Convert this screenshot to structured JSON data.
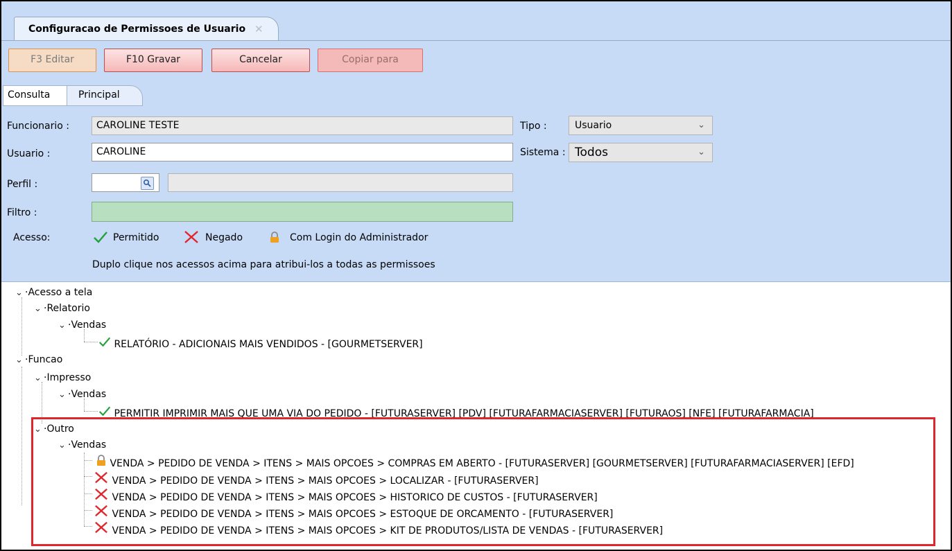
{
  "window": {
    "tab_title": "Configuracao de Permissoes de Usuario",
    "tab_close": "✕"
  },
  "toolbar": {
    "edit_label": "F3 Editar",
    "save_label": "F10 Gravar",
    "cancel_label": "Cancelar",
    "copy_label": "Copiar para"
  },
  "tabs": [
    {
      "label": "Consulta"
    },
    {
      "label": "Principal"
    }
  ],
  "form": {
    "funcionario_label": "Funcionario :",
    "funcionario_value": "CAROLINE TESTE",
    "usuario_label": "Usuario :",
    "usuario_value": "CAROLINE",
    "perfil_label": "Perfil :",
    "perfil_value": "",
    "filtro_label": "Filtro :",
    "filtro_value": "",
    "tipo_label": "Tipo :",
    "tipo_value": "Usuario",
    "sistema_label": "Sistema :",
    "sistema_value": "Todos"
  },
  "access": {
    "label": "Acesso:",
    "permitted": "Permitido",
    "denied": "Negado",
    "admin": "Com Login do Administrador",
    "hint": "Duplo clique nos acessos acima para atribui-los a todas as permissoes"
  },
  "colors": {
    "panel_bg": "#c7dbf6",
    "check_green": "#22a03a",
    "deny_red": "#e0252b",
    "lock_orange": "#f0a020",
    "highlight_red": "#e0252b"
  },
  "tree": {
    "acesso_a_tela": "Acesso a tela",
    "relatorio": "Relatorio",
    "vendas_1": "Vendas",
    "item_1": "RELATÓRIO - ADICIONAIS MAIS VENDIDOS - [GOURMETSERVER]",
    "funcao": "Funcao",
    "impresso": "Impresso",
    "vendas_2": "Vendas",
    "item_2": "PERMITIR IMPRIMIR MAIS QUE UMA VIA DO PEDIDO - [FUTURASERVER] [PDV] [FUTURAFARMACIASERVER] [FUTURAOS] [NFE] [FUTURAFARMACIA]",
    "outro": "Outro",
    "vendas_3": "Vendas",
    "item_3": "VENDA > PEDIDO DE VENDA > ITENS > MAIS OPCOES > COMPRAS EM ABERTO - [FUTURASERVER] [GOURMETSERVER] [FUTURAFARMACIASERVER] [EFD]",
    "item_4": "VENDA > PEDIDO DE VENDA > ITENS > MAIS OPCOES > LOCALIZAR - [FUTURASERVER]",
    "item_5": "VENDA > PEDIDO DE VENDA > ITENS > MAIS OPCOES > HISTORICO DE CUSTOS - [FUTURASERVER]",
    "item_6": "VENDA > PEDIDO DE VENDA > ITENS > MAIS OPCOES > ESTOQUE DE ORCAMENTO - [FUTURASERVER]",
    "item_7": "VENDA > PEDIDO DE VENDA > ITENS > MAIS OPCOES > KIT DE PRODUTOS/LISTA DE VENDAS - [FUTURASERVER]"
  }
}
